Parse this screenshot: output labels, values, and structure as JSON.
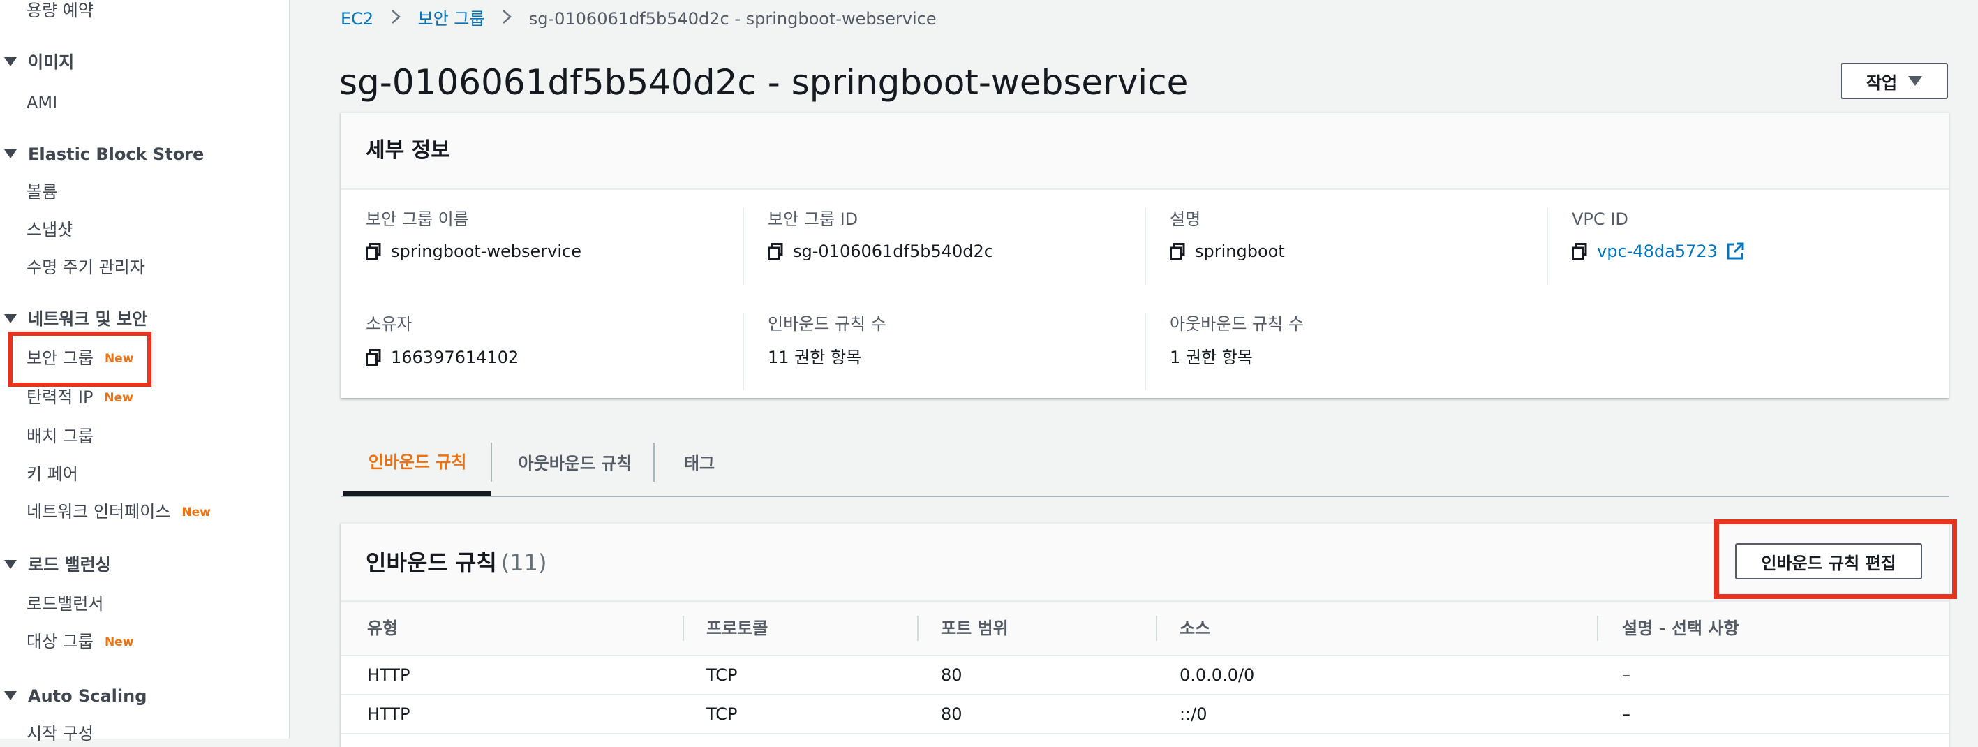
{
  "sidebar": {
    "top_item": "용량 예약",
    "sections": [
      {
        "title": "이미지",
        "items": [
          {
            "label": "AMI"
          }
        ]
      },
      {
        "title": "Elastic Block Store",
        "items": [
          {
            "label": "볼륨"
          },
          {
            "label": "스냅샷"
          },
          {
            "label": "수명 주기 관리자"
          }
        ]
      },
      {
        "title": "네트워크 및 보안",
        "items": [
          {
            "label": "보안 그룹",
            "badge": "New"
          },
          {
            "label": "탄력적 IP",
            "badge": "New"
          },
          {
            "label": "배치 그룹"
          },
          {
            "label": "키 페어"
          },
          {
            "label": "네트워크 인터페이스",
            "badge": "New"
          }
        ]
      },
      {
        "title": "로드 밸런싱",
        "items": [
          {
            "label": "로드밸런서"
          },
          {
            "label": "대상 그룹",
            "badge": "New"
          }
        ]
      },
      {
        "title": "Auto Scaling",
        "items": [
          {
            "label": "시작 구성"
          }
        ]
      }
    ]
  },
  "breadcrumb": {
    "items": [
      "EC2",
      "보안 그룹"
    ],
    "current": "sg-0106061df5b540d2c - springboot-webservice"
  },
  "page": {
    "title": "sg-0106061df5b540d2c - springboot-webservice",
    "actions_label": "작업"
  },
  "details": {
    "title": "세부 정보",
    "fields": [
      {
        "label": "보안 그룹 이름",
        "value": "springboot-webservice"
      },
      {
        "label": "보안 그룹 ID",
        "value": "sg-0106061df5b540d2c"
      },
      {
        "label": "설명",
        "value": "springboot"
      },
      {
        "label": "VPC ID",
        "value": "vpc-48da5723"
      },
      {
        "label": "소유자",
        "value": "166397614102"
      },
      {
        "label": "인바운드 규칙 수",
        "value": "11 권한 항목"
      },
      {
        "label": "아웃바운드 규칙 수",
        "value": "1 권한 항목"
      }
    ]
  },
  "tabs": [
    "인바운드 규칙",
    "아웃바운드 규칙",
    "태그"
  ],
  "inbound": {
    "title": "인바운드 규칙",
    "count": "(11)",
    "edit_label": "인바운드 규칙 편집",
    "columns": [
      "유형",
      "프로토콜",
      "포트 범위",
      "소스",
      "설명 - 선택 사항"
    ],
    "rows": [
      [
        "HTTP",
        "TCP",
        "80",
        "0.0.0.0/0",
        "–"
      ],
      [
        "HTTP",
        "TCP",
        "80",
        "::/0",
        "–"
      ]
    ]
  },
  "colors": {
    "accent_orange": "#ec7211",
    "link_blue": "#0073bb",
    "highlight_red": "#e8331f"
  }
}
